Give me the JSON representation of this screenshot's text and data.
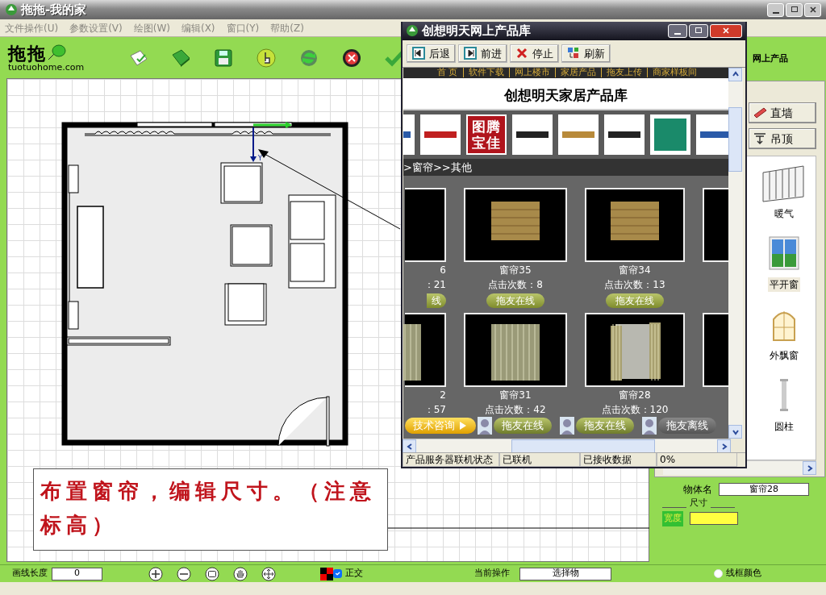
{
  "window": {
    "title": "拖拖-我的家"
  },
  "menu": [
    "文件操作(U)",
    "参数设置(V)",
    "绘图(W)",
    "编辑(X)",
    "窗口(Y)",
    "帮助(Z)"
  ],
  "logo": {
    "mark": "拖拖",
    "site": "tuotuohome.com"
  },
  "annotation": {
    "text": "布置窗帘，编辑尺寸。（注意标高）"
  },
  "floor_plan": {
    "axis_label": "Y"
  },
  "right_panel": {
    "header": "网上产品",
    "buttons": [
      {
        "kind": "wall",
        "label": "直墙"
      },
      {
        "kind": "ceiling",
        "label": "吊顶"
      }
    ],
    "items": [
      {
        "kind": "radiator",
        "label": "暖气",
        "selected": false
      },
      {
        "kind": "casement",
        "label": "平开窗",
        "selected": true
      },
      {
        "kind": "bay",
        "label": "外飘窗",
        "selected": false
      },
      {
        "kind": "column",
        "label": "圆柱",
        "selected": false
      }
    ]
  },
  "properties": {
    "name_label": "物体名",
    "name_value": "窗帘28",
    "group_label": "尺寸",
    "width_label": "宽度"
  },
  "status_bar": {
    "length_label": "画线长度",
    "length_value": "0",
    "ortho": {
      "label": "正交",
      "checked": true
    },
    "operation_label": "当前操作",
    "operation_value": "选择物",
    "wire_color": {
      "label": "线框颜色",
      "selected": false
    }
  },
  "popup": {
    "title": "创想明天网上产品库",
    "nav_buttons": [
      {
        "kind": "back",
        "label": "后退"
      },
      {
        "kind": "forward",
        "label": "前进"
      },
      {
        "kind": "stop",
        "label": "停止"
      },
      {
        "kind": "refresh",
        "label": "刷新"
      }
    ],
    "site_nav": [
      "首 页",
      "软件下载",
      "网上楼市",
      "家居产品",
      "拖友上传",
      "商家样板间"
    ],
    "heading": "创想明天家居产品库",
    "seal_logo": "图腾宝佳",
    "breadcrumb": ">窗帘>>其他",
    "products": [
      {
        "kind": "clip_left",
        "photo": {
          "kind": "empty"
        },
        "name": "6",
        "clicks": "：21",
        "button": "线"
      },
      {
        "kind": "full",
        "photo": {
          "kind": "roman"
        },
        "name": "窗帘35",
        "clicks": "点击次数：8",
        "button": "拖友在线"
      },
      {
        "kind": "full",
        "photo": {
          "kind": "roman"
        },
        "name": "窗帘34",
        "clicks": "点击次数：13",
        "button": "拖友在线"
      },
      {
        "kind": "clip_right",
        "photo": {
          "kind": "empty"
        }
      },
      {
        "kind": "clip_left",
        "photo": {
          "kind": "drape"
        },
        "name": "2",
        "clicks": "：57"
      },
      {
        "kind": "full",
        "photo": {
          "kind": "drape"
        },
        "name": "窗帘31",
        "clicks": "点击次数：42"
      },
      {
        "kind": "full",
        "photo": {
          "kind": "open"
        },
        "name": "窗帘28",
        "clicks": "点击次数：120"
      },
      {
        "kind": "clip_right",
        "photo": {
          "kind": "empty"
        }
      }
    ],
    "chat_bar": [
      {
        "kind": "consult",
        "label": "技术咨询"
      },
      {
        "kind": "online",
        "label": "拖友在线"
      },
      {
        "kind": "online",
        "label": "拖友在线"
      },
      {
        "kind": "offline",
        "label": "拖友离线"
      }
    ],
    "status": [
      "产品服务器联机状态",
      "已联机",
      "已接收数据",
      "0%"
    ]
  }
}
